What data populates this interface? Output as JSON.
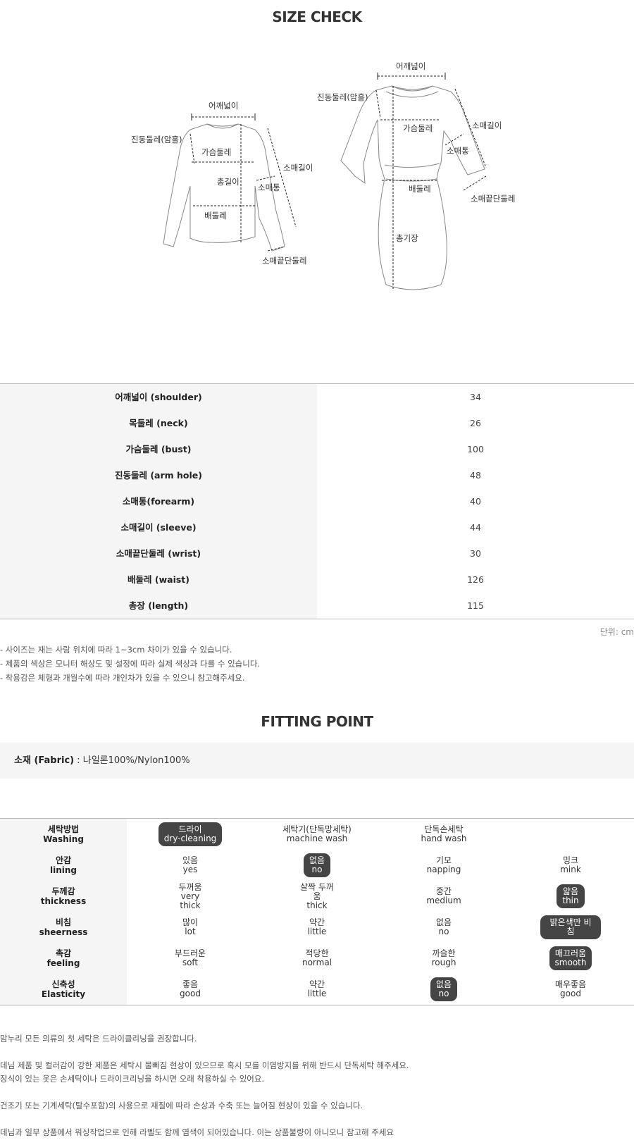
{
  "title": "SIZE CHECK",
  "diagram": {
    "left": {
      "shoulder": "어깨넓이",
      "armhole": "진동둘레(암홀)",
      "bust": "가슴둘레",
      "length": "총길이",
      "forearm": "소매통",
      "sleeve": "소매길이",
      "waist": "배둘레",
      "wrist": "소매끝단둘레"
    },
    "right": {
      "shoulder": "어깨넓이",
      "armhole": "진동둘레(암홀)",
      "bust": "가슴둘레",
      "sleeve": "소매길이",
      "forearm": "소매통",
      "waist": "배둘레",
      "wrist": "소매끝단둘레",
      "length": "총기장"
    }
  },
  "size_table": [
    {
      "label": "어깨넓이 (shoulder)",
      "value": "34"
    },
    {
      "label": "목둘레 (neck)",
      "value": "26"
    },
    {
      "label": "가슴둘레 (bust)",
      "value": "100"
    },
    {
      "label": "진동둘레 (arm hole)",
      "value": "48"
    },
    {
      "label": "소매통(forearm)",
      "value": "40"
    },
    {
      "label": "소매길이 (sleeve)",
      "value": "44"
    },
    {
      "label": "소매끝단둘레 (wrist)",
      "value": "30"
    },
    {
      "label": "배둘레 (waist)",
      "value": "126"
    },
    {
      "label": "총장 (length)",
      "value": "115"
    }
  ],
  "unit": "단위: cm",
  "notes": [
    "- 사이즈는 재는 사람 위치에 따라 1~3cm 차이가 있을 수 있습니다.",
    "- 제품의 색상은 모니터 해상도 및 설정에 따라 실제 색상과 다를 수 있습니다.",
    "- 착용감은 체형과 개월수에 따라 개인차가 있을 수 있으니 참고해주세요."
  ],
  "fitting_title": "FITTING POINT",
  "fabric": {
    "label": "소재 (Fabric)",
    "value": " : 나일론100%/Nylon100%"
  },
  "fitting": [
    {
      "ko": "세탁방법",
      "en": "Washing",
      "options": [
        {
          "ko": "드라이",
          "en": "dry-cleaning",
          "selected": true
        },
        {
          "ko": "세탁기(단독망세탁)",
          "en": "machine wash",
          "selected": false
        },
        {
          "ko": "단독손세탁",
          "en": "hand wash",
          "selected": false
        }
      ]
    },
    {
      "ko": "안감",
      "en": "lining",
      "options": [
        {
          "ko": "있음",
          "en": "yes",
          "selected": false
        },
        {
          "ko": "없음",
          "en": "no",
          "selected": true
        },
        {
          "ko": "기모",
          "en": "napping",
          "selected": false
        },
        {
          "ko": "밍크",
          "en": "mink",
          "selected": false
        }
      ]
    },
    {
      "ko": "두께감",
      "en": "thickness",
      "options": [
        {
          "ko": "두꺼움",
          "en": "very thick",
          "selected": false
        },
        {
          "ko": "살짝 두꺼움",
          "en": "thick",
          "selected": false
        },
        {
          "ko": "중간",
          "en": "medium",
          "selected": false
        },
        {
          "ko": "얇음",
          "en": "thin",
          "selected": true
        }
      ]
    },
    {
      "ko": "비침",
      "en": "sheerness",
      "options": [
        {
          "ko": "많이",
          "en": "lot",
          "selected": false
        },
        {
          "ko": "약간",
          "en": "little",
          "selected": false
        },
        {
          "ko": "없음",
          "en": "no",
          "selected": false
        },
        {
          "ko": "밝은색만 비침",
          "en": "",
          "selected": true
        }
      ]
    },
    {
      "ko": "촉감",
      "en": "feeling",
      "options": [
        {
          "ko": "부드러운",
          "en": "soft",
          "selected": false
        },
        {
          "ko": "적당한",
          "en": "normal",
          "selected": false
        },
        {
          "ko": "까슬한",
          "en": "rough",
          "selected": false
        },
        {
          "ko": "매끄러움",
          "en": "smooth",
          "selected": true
        }
      ]
    },
    {
      "ko": "신축성",
      "en": "Elasticity",
      "options": [
        {
          "ko": "좋음",
          "en": "good",
          "selected": false
        },
        {
          "ko": "약간",
          "en": "little",
          "selected": false
        },
        {
          "ko": "없음",
          "en": "no",
          "selected": true
        },
        {
          "ko": "매우좋음",
          "en": "good",
          "selected": false
        }
      ]
    }
  ],
  "care": [
    "맘누리 모든 의류의 첫 세탁은 드라이클리닝을 권장합니다.",
    "",
    "데님 제품 및 컬러감이 강한 제품은 세탁시 물빠짐 현상이 있으므로 혹시 모를 이염방지를 위해 반드시 단독세탁 해주세요.",
    "장식이 있는 옷은 손세탁이나 드라이크리닝을 하시면 오래 착용하실 수 있어요.",
    "",
    "건조기 또는 기계세탁(탈수포함)의 사용으로 재질에 따라 손상과 수축 또는 늘어짐 현상이 있을 수 있습니다.",
    "",
    "데님과 일부 상품에서 워싱작업으로 인해 라벨도 함께 염색이 되어있습니다. 이는 상품불량이 아니오니 참고해 주세요"
  ]
}
